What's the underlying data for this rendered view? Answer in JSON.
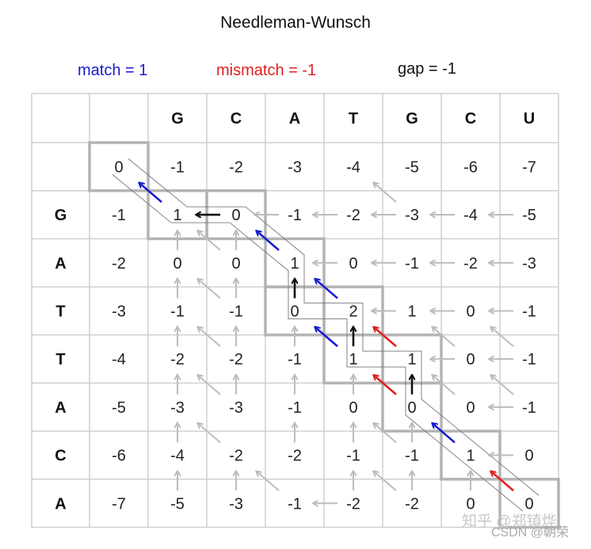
{
  "title": "Needleman-Wunsch",
  "legend": {
    "match": {
      "label": "match = 1",
      "color": "#1a1ad0"
    },
    "mismatch": {
      "label": "mismatch = -1",
      "color": "#e02020"
    },
    "gap": {
      "label": "gap = -1",
      "color": "#111111"
    }
  },
  "top_sequence": [
    "G",
    "C",
    "A",
    "T",
    "G",
    "C",
    "U"
  ],
  "left_sequence": [
    "G",
    "A",
    "T",
    "T",
    "A",
    "C",
    "A"
  ],
  "scores": [
    [
      "0",
      "-1",
      "-2",
      "-3",
      "-4",
      "-5",
      "-6",
      "-7"
    ],
    [
      "-1",
      "1",
      "0",
      "-1",
      "-2",
      "-3",
      "-4",
      "-5"
    ],
    [
      "-2",
      "0",
      "0",
      "1",
      "0",
      "-1",
      "-2",
      "-3"
    ],
    [
      "-3",
      "-1",
      "-1",
      "0",
      "2",
      "1",
      "0",
      "-1"
    ],
    [
      "-4",
      "-2",
      "-2",
      "-1",
      "1",
      "1",
      "0",
      "-1"
    ],
    [
      "-5",
      "-3",
      "-3",
      "-1",
      "0",
      "0",
      "0",
      "-1"
    ],
    [
      "-6",
      "-4",
      "-2",
      "-2",
      "-1",
      "-1",
      "1",
      "0"
    ],
    [
      "-7",
      "-5",
      "-3",
      "-1",
      "-2",
      "-2",
      "0",
      "0"
    ]
  ],
  "traceback_path": [
    {
      "cell": [
        1,
        1
      ],
      "dir": "diag",
      "type": "match"
    },
    {
      "cell": [
        1,
        2
      ],
      "dir": "left",
      "type": "gap"
    },
    {
      "cell": [
        2,
        3
      ],
      "dir": "diag",
      "type": "match"
    },
    {
      "cell": [
        3,
        3
      ],
      "dir": "up",
      "type": "gap"
    },
    {
      "cell": [
        3,
        4
      ],
      "dir": "diag",
      "type": "match"
    },
    {
      "cell": [
        4,
        4
      ],
      "dir": "diag",
      "type": "match"
    },
    {
      "cell": [
        4,
        4
      ],
      "dir": "up",
      "type": "gap"
    },
    {
      "cell": [
        4,
        5
      ],
      "dir": "diag",
      "type": "mismatch"
    },
    {
      "cell": [
        5,
        5
      ],
      "dir": "diag",
      "type": "mismatch"
    },
    {
      "cell": [
        5,
        5
      ],
      "dir": "up",
      "type": "gap"
    },
    {
      "cell": [
        6,
        6
      ],
      "dir": "diag",
      "type": "match"
    },
    {
      "cell": [
        7,
        7
      ],
      "dir": "diag",
      "type": "mismatch"
    }
  ],
  "highlighted_cells": [
    [
      0,
      0
    ],
    [
      1,
      1
    ],
    [
      1,
      2
    ],
    [
      2,
      3
    ],
    [
      3,
      3
    ],
    [
      3,
      4
    ],
    [
      4,
      4
    ],
    [
      4,
      5
    ],
    [
      5,
      5
    ],
    [
      6,
      6
    ],
    [
      7,
      7
    ]
  ],
  "other_pointers": [
    [
      1,
      5,
      "diag"
    ],
    [
      1,
      3,
      "left"
    ],
    [
      1,
      4,
      "left"
    ],
    [
      1,
      5,
      "left"
    ],
    [
      1,
      6,
      "left"
    ],
    [
      1,
      7,
      "left"
    ],
    [
      2,
      4,
      "left"
    ],
    [
      2,
      5,
      "left"
    ],
    [
      2,
      6,
      "left"
    ],
    [
      2,
      7,
      "left"
    ],
    [
      2,
      1,
      "up"
    ],
    [
      2,
      2,
      "diag"
    ],
    [
      2,
      2,
      "up"
    ],
    [
      3,
      1,
      "up"
    ],
    [
      3,
      2,
      "up"
    ],
    [
      3,
      2,
      "diag"
    ],
    [
      3,
      5,
      "left"
    ],
    [
      3,
      6,
      "left"
    ],
    [
      3,
      7,
      "left"
    ],
    [
      4,
      1,
      "up"
    ],
    [
      4,
      2,
      "up"
    ],
    [
      4,
      2,
      "diag"
    ],
    [
      4,
      3,
      "up"
    ],
    [
      4,
      6,
      "left"
    ],
    [
      4,
      7,
      "left"
    ],
    [
      4,
      6,
      "diag"
    ],
    [
      4,
      7,
      "diag"
    ],
    [
      5,
      1,
      "up"
    ],
    [
      5,
      2,
      "up"
    ],
    [
      5,
      2,
      "diag"
    ],
    [
      5,
      3,
      "up"
    ],
    [
      5,
      4,
      "up"
    ],
    [
      5,
      7,
      "left"
    ],
    [
      5,
      6,
      "diag"
    ],
    [
      5,
      7,
      "diag"
    ],
    [
      6,
      1,
      "up"
    ],
    [
      6,
      2,
      "diag"
    ],
    [
      6,
      3,
      "up"
    ],
    [
      6,
      4,
      "up"
    ],
    [
      6,
      5,
      "up"
    ],
    [
      6,
      5,
      "diag"
    ],
    [
      6,
      7,
      "left"
    ],
    [
      7,
      1,
      "up"
    ],
    [
      7,
      2,
      "up"
    ],
    [
      7,
      3,
      "diag"
    ],
    [
      7,
      4,
      "left"
    ],
    [
      7,
      4,
      "up"
    ],
    [
      7,
      5,
      "up"
    ],
    [
      7,
      5,
      "diag"
    ],
    [
      7,
      6,
      "up"
    ]
  ],
  "watermark": {
    "zhihu": "知乎 @郑镇烨",
    "csdn": "CSDN @朝荣"
  }
}
